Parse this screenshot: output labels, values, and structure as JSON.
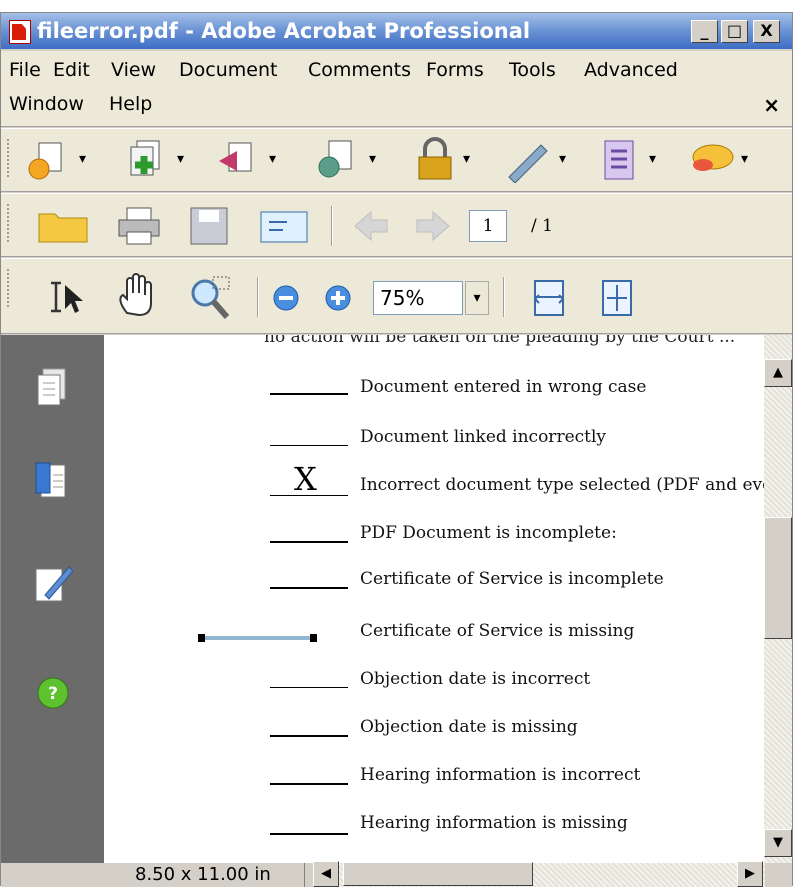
{
  "window": {
    "title": "fileerror.pdf - Adobe Acrobat Professional",
    "minimize": "_",
    "maximize": "□",
    "close": "X"
  },
  "menu": {
    "items": [
      "File",
      "Edit",
      "View",
      "Document",
      "Comments",
      "Forms",
      "Tools",
      "Advanced",
      "Window",
      "Help"
    ],
    "close_glyph": "×"
  },
  "toolbar": {
    "page_current": "1",
    "page_total": "/ 1",
    "zoom": "75%",
    "dropdown_glyph": "▾"
  },
  "document": {
    "cut_text": "no action will be taken on the pleading by the Court ... ",
    "checklist": [
      {
        "label": "Document entered in wrong case",
        "mark": ""
      },
      {
        "label": "Document linked incorrectly",
        "mark": ""
      },
      {
        "label": "Incorrect document type selected (PDF and even",
        "mark": "X"
      },
      {
        "label": "PDF Document is incomplete:",
        "mark": ""
      },
      {
        "label": "Certificate of Service is incomplete",
        "mark": ""
      },
      {
        "label": "Certificate of Service is missing",
        "mark": ""
      },
      {
        "label": "Objection date is incorrect",
        "mark": ""
      },
      {
        "label": "Objection date is missing",
        "mark": ""
      },
      {
        "label": "Hearing information is incorrect",
        "mark": ""
      },
      {
        "label": "Hearing information is missing",
        "mark": ""
      }
    ]
  },
  "status": {
    "page_size": "8.50 x 11.00 in"
  },
  "colors": {
    "titlebar": "#3d6cc4",
    "navpane": "#6b6b6b",
    "selected_line": "#8fb8d0"
  }
}
